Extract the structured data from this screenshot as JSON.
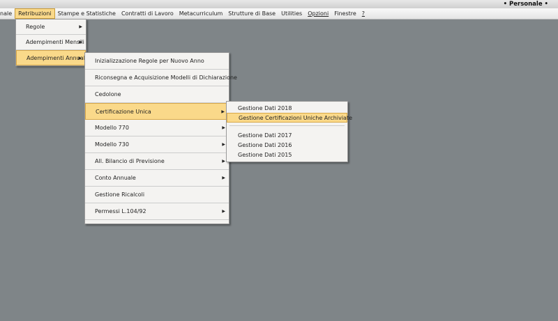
{
  "window": {
    "title": "• Personale •"
  },
  "menubar": [
    "nale",
    "Retribuzioni",
    "Stampe e Statistiche",
    "Contratti di Lavoro",
    "Metacurriculum",
    "Strutture di Base",
    "Utilities",
    "Opzioni",
    "Finestre",
    "?"
  ],
  "menu_retribuzioni": [
    {
      "label": "Regole",
      "submenu": true
    },
    {
      "label": "Adempimenti Mensili",
      "submenu": true
    },
    {
      "label": "Adempimenti Annuali",
      "submenu": true,
      "highlighted": true
    }
  ],
  "menu_adempimenti_annuali": [
    {
      "label": "Inizializzazione Regole per Nuovo Anno",
      "submenu": false
    },
    {
      "label": "Riconsegna e Acquisizione Modelli di Dichiarazione",
      "submenu": false
    },
    {
      "label": "Cedolone",
      "submenu": false
    },
    {
      "label": "Certificazione Unica",
      "submenu": true,
      "highlighted": true
    },
    {
      "label": "Modello 770",
      "submenu": true
    },
    {
      "label": "Modello 730",
      "submenu": true
    },
    {
      "label": "All. Bilancio di Previsione",
      "submenu": true
    },
    {
      "label": "Conto Annuale",
      "submenu": true
    },
    {
      "label": "Gestione Ricalcoli",
      "submenu": false
    },
    {
      "label": "Permessi L.104/92",
      "submenu": true
    }
  ],
  "menu_certificazione_unica": [
    {
      "label": "Gestione Dati 2018"
    },
    {
      "label": "Gestione Certificazioni Uniche Archiviate",
      "highlighted": true
    },
    {
      "label": "Gestione Dati 2017"
    },
    {
      "label": "Gestione Dati 2016"
    },
    {
      "label": "Gestione Dati 2015"
    }
  ]
}
